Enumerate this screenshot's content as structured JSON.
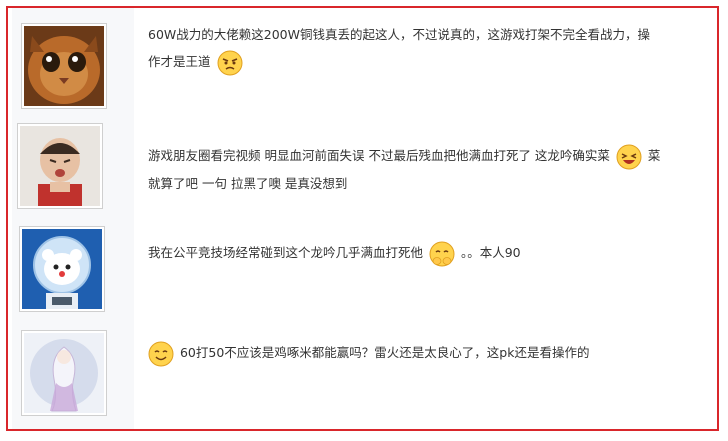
{
  "comments": [
    {
      "avatar": "orange-cat-avatar",
      "line1": "60W战力的大佬赖这200W铜钱真丢的起这人，不过说真的，这游戏打架不完全看战力，操",
      "line2": "作才是王道",
      "emoji": "angry-face-emoji"
    },
    {
      "avatar": "crying-child-avatar",
      "line1a": "游戏朋友圈看完视频 明显血河前面失误 不过最后残血把他满血打死了 这龙吟确实菜",
      "line1b": "菜",
      "line2": "就算了吧 一句 拉黑了噢 是真没想到",
      "emoji": "laughing-face-emoji"
    },
    {
      "avatar": "polar-bear-astronaut-avatar",
      "text_before": "我在公平竞技场经常碰到这个龙吟几乎满血打死他",
      "text_after": "。。本人90",
      "emoji": "covering-mouth-emoji"
    },
    {
      "avatar": "anime-girl-avatar",
      "text": "60打50不应该是鸡啄米都能赢吗？雷火还是太良心了，这pk还是看操作的",
      "emoji": "smile-face-emoji"
    }
  ],
  "colors": {
    "border": "#d9262b",
    "text": "#333333",
    "sidebar": "#f7f8fa"
  }
}
